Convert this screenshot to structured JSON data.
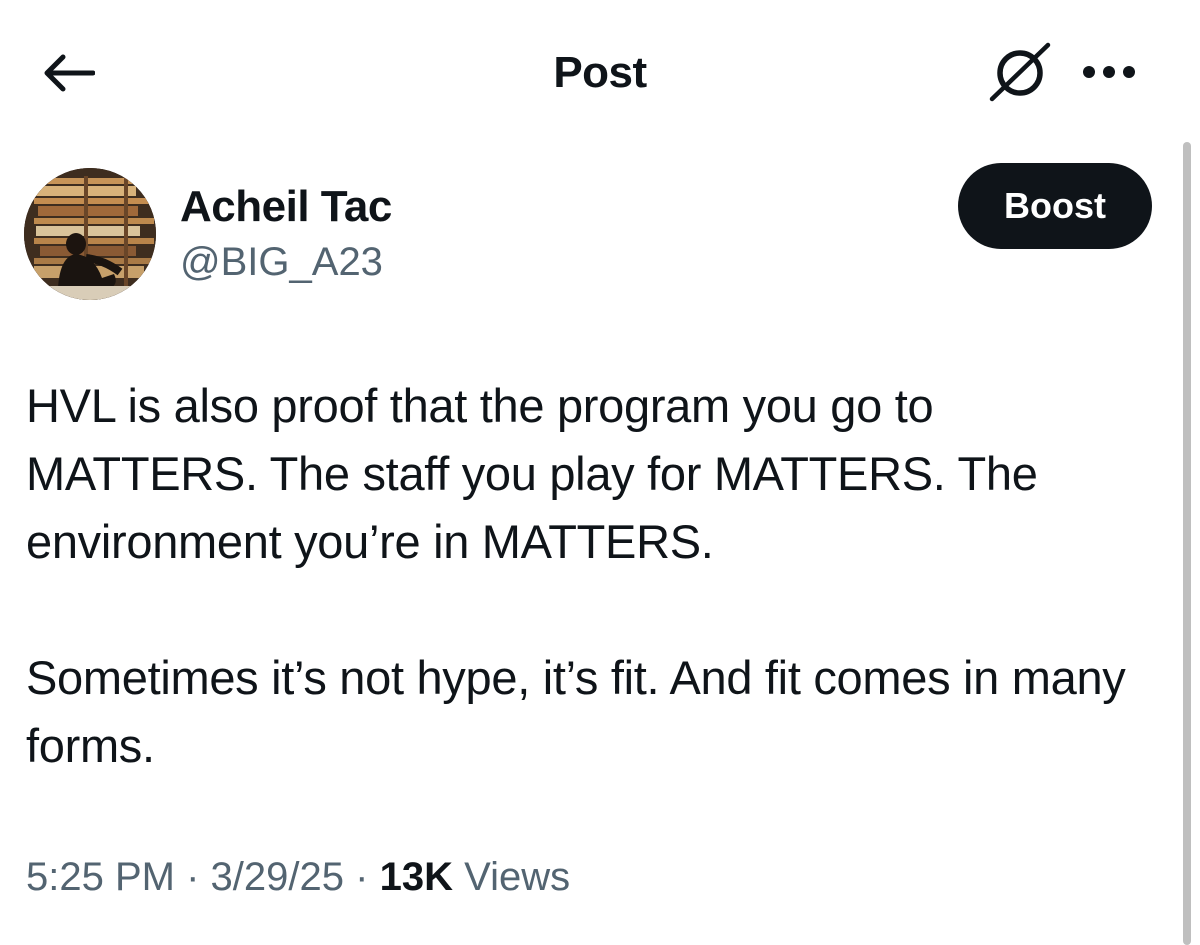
{
  "header": {
    "title": "Post",
    "back_icon": "arrow-left-icon",
    "grok_icon": "grok-icon",
    "more_icon": "more-horizontal-icon"
  },
  "author": {
    "name": "Acheil Tac",
    "handle": "@BIG_A23"
  },
  "boost": {
    "label": "Boost"
  },
  "post": {
    "paragraphs": [
      "HVL is also proof that the program you go to MATTERS. The staff you play for MATTERS. The environment you’re in MATTERS.",
      "Sometimes it’s not hype, it’s fit. And fit comes in many forms."
    ]
  },
  "meta": {
    "time": "5:25 PM",
    "separator": "·",
    "date": "3/29/25",
    "views_count": "13K",
    "views_label": "Views"
  },
  "colors": {
    "text_primary": "#0f1419",
    "text_secondary": "#536471",
    "button_bg": "#0f1419",
    "background": "#ffffff"
  }
}
